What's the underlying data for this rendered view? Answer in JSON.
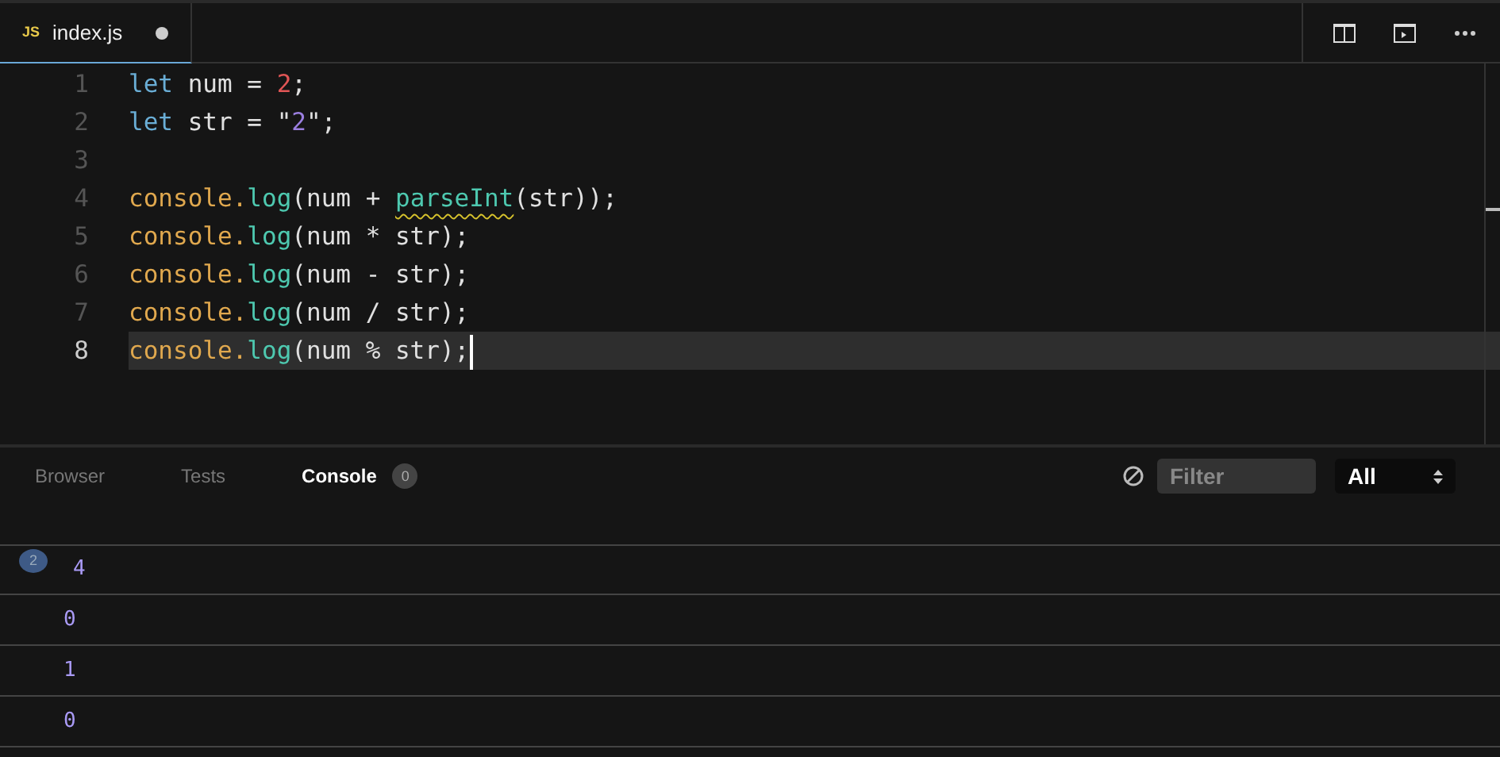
{
  "tabs": [
    {
      "badge": "JS",
      "label": "index.js",
      "modified": true,
      "selected": true
    }
  ],
  "code_lines": [
    {
      "number": "1",
      "current": false,
      "tokens": [
        {
          "kind": "keyword",
          "text": "let"
        },
        {
          "kind": "plain",
          "text": " num = "
        },
        {
          "kind": "number",
          "text": "2"
        },
        {
          "kind": "plain",
          "text": ";"
        }
      ]
    },
    {
      "number": "2",
      "current": false,
      "tokens": [
        {
          "kind": "keyword",
          "text": "let"
        },
        {
          "kind": "plain",
          "text": " str = \""
        },
        {
          "kind": "string",
          "text": "2"
        },
        {
          "kind": "plain",
          "text": "\";"
        }
      ]
    },
    {
      "number": "3",
      "current": false
    },
    {
      "number": "4",
      "current": false,
      "tokens": [
        {
          "kind": "object",
          "text": "console."
        },
        {
          "kind": "method",
          "text": "log"
        },
        {
          "kind": "plain",
          "text": "(num + "
        },
        {
          "kind": "function",
          "text": "parseInt",
          "warning": true
        },
        {
          "kind": "plain",
          "text": "(str));"
        }
      ]
    },
    {
      "number": "5",
      "current": false,
      "tokens": [
        {
          "kind": "object",
          "text": "console."
        },
        {
          "kind": "method",
          "text": "log"
        },
        {
          "kind": "plain",
          "text": "(num * str);"
        }
      ]
    },
    {
      "number": "6",
      "current": false,
      "tokens": [
        {
          "kind": "object",
          "text": "console."
        },
        {
          "kind": "method",
          "text": "log"
        },
        {
          "kind": "plain",
          "text": "(num - str);"
        }
      ]
    },
    {
      "number": "7",
      "current": false,
      "tokens": [
        {
          "kind": "object",
          "text": "console."
        },
        {
          "kind": "method",
          "text": "log"
        },
        {
          "kind": "plain",
          "text": "(num / str);"
        }
      ]
    },
    {
      "number": "8",
      "current": true,
      "tokens": [
        {
          "kind": "object",
          "text": "console."
        },
        {
          "kind": "method",
          "text": "log"
        },
        {
          "kind": "plain",
          "text": "(num % str);"
        }
      ]
    }
  ],
  "panel_tabs": [
    {
      "label": "Browser",
      "selected": false
    },
    {
      "label": "Tests",
      "selected": false
    },
    {
      "label": "Console",
      "selected": true,
      "count": "0"
    }
  ],
  "filter": {
    "placeholder": "Filter"
  },
  "level_select": {
    "value": "All"
  },
  "console_rows": [
    {
      "repeat": "2",
      "value": "4"
    },
    {
      "value": "0"
    },
    {
      "value": "1"
    },
    {
      "value": "0"
    }
  ]
}
